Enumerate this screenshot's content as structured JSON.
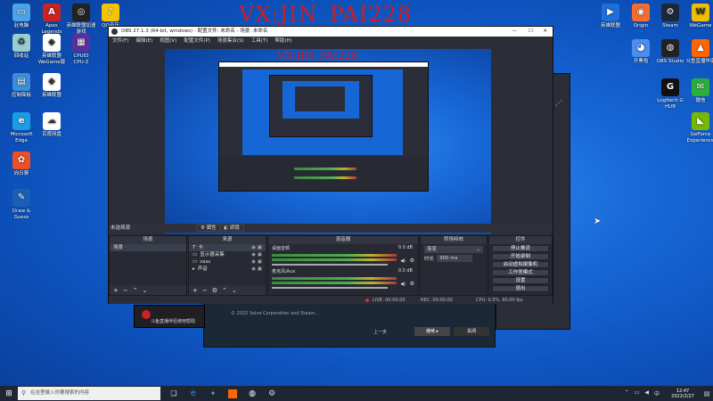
{
  "watermark": "VX:JIN_PAI228",
  "preview_watermark": "VX:JIN_PAI228",
  "desktop_left": [
    {
      "label": "此电脑",
      "icon": "computer-icon",
      "color": "#4aa3e6",
      "glyph": "▭"
    },
    {
      "label": "Apex\nLegends",
      "icon": "apex-icon",
      "color": "#c22",
      "glyph": "A"
    },
    {
      "label": "英雄联盟加速\n游戏",
      "icon": "lol-icon",
      "color": "#222",
      "glyph": "◎"
    },
    {
      "label": "QQ音乐",
      "icon": "qqmusic-icon",
      "color": "#f5c400",
      "glyph": "♪"
    },
    {
      "label": "回收站",
      "icon": "recycle-bin-icon",
      "color": "#9cc",
      "glyph": "♻"
    },
    {
      "label": "英雄联盟\nWeGame版",
      "icon": "wegame-lol-icon",
      "color": "#fff",
      "glyph": "◆"
    },
    {
      "label": "CPUID\nCPU-Z",
      "icon": "cpuz-icon",
      "color": "#5a2fa0",
      "glyph": "▦"
    },
    {
      "label": "控制面板",
      "icon": "control-panel-icon",
      "color": "#3a8fd9",
      "glyph": "▤"
    },
    {
      "label": "英雄联盟",
      "icon": "lol2-icon",
      "color": "#fff",
      "glyph": "◆"
    },
    {
      "label": "Microsoft\nEdge",
      "icon": "edge-icon",
      "color": "#1b9de2",
      "glyph": "e"
    },
    {
      "label": "百度网盘",
      "icon": "baidu-icon",
      "color": "#fff",
      "glyph": "☁"
    },
    {
      "label": "向日葵",
      "icon": "sunlogin-icon",
      "color": "#f04f23",
      "glyph": "✿"
    },
    {
      "label": "Draw &\nGuess",
      "icon": "draw-guess-icon",
      "color": "#1a5fb4",
      "glyph": "✎"
    }
  ],
  "desktop_right": [
    {
      "label": "英雄联盟",
      "icon": "lol-right-icon",
      "color": "#1e6fd9",
      "glyph": "▶"
    },
    {
      "label": "Origin",
      "icon": "origin-icon",
      "color": "#f56c2d",
      "glyph": "◉"
    },
    {
      "label": "Steam",
      "icon": "steam-icon",
      "color": "#1b2838",
      "glyph": "⚙"
    },
    {
      "label": "WeGame",
      "icon": "wegame-icon",
      "color": "#f0c000",
      "glyph": "W"
    },
    {
      "label": "开黑啦",
      "icon": "kaiheila-icon",
      "color": "#4a8ef0",
      "glyph": "◕"
    },
    {
      "label": "OBS Studio",
      "icon": "obs-icon",
      "color": "#222",
      "glyph": "◍"
    },
    {
      "label": "斗鱼直播伴侣",
      "icon": "douyu-icon",
      "color": "#f60",
      "glyph": "▲"
    },
    {
      "label": "Logitech G\nHUB",
      "icon": "ghub-icon",
      "color": "#111",
      "glyph": "G"
    },
    {
      "label": "微信",
      "icon": "wechat-icon",
      "color": "#2bae3c",
      "glyph": "✉"
    },
    {
      "label": "GeForce\nExperience",
      "icon": "geforce-icon",
      "color": "#76b900",
      "glyph": "◣"
    }
  ],
  "obs": {
    "title": "OBS 27.1.3 (64-bit, windows) - 配置文件: 未命名 - 场景: 未命名",
    "menu": [
      "文件(F)",
      "编辑(E)",
      "视图(V)",
      "配置文件(P)",
      "场景集合(S)",
      "工具(T)",
      "帮助(H)"
    ],
    "selected_source": "未选择源",
    "props_button": "属性",
    "filters_button": "滤镜",
    "docks": {
      "scenes": "场景",
      "sources": "来源",
      "mixer": "混音器",
      "transitions": "转场特效",
      "controls": "控件"
    },
    "scene_item": "场景",
    "sources": [
      {
        "name": "卡",
        "kind": "T"
      },
      {
        "name": "显示器采集",
        "kind": "▭"
      },
      {
        "name": "sass",
        "kind": "▭"
      },
      {
        "name": "声音",
        "kind": "▸"
      }
    ],
    "mixer": [
      {
        "name": "桌面音频",
        "db": "0.0 dB"
      },
      {
        "name": "麦克风/Aux",
        "db": "0.0 dB"
      }
    ],
    "transition_type": "渐变",
    "duration_label": "时长",
    "duration_value": "300 ms",
    "controls": [
      "停止推流",
      "开始录制",
      "启动虚拟摄像机",
      "工作室模式",
      "设置",
      "退出"
    ],
    "status": {
      "live": "LIVE: 00:00:00",
      "rec": "REC: 00:00:00",
      "cpu": "CPU: 0.5%, 60.00 fps"
    }
  },
  "bg_window": {
    "footer": "© 2022 Valve Corporation and Steam...",
    "btn1": "上一步",
    "btn2": "继续 ▸",
    "btn3": "关闭"
  },
  "douyu_popup": "斗鱼直播伴侣使用帮助",
  "taskbar": {
    "search_placeholder": "在这里输入你要搜索的内容",
    "time": "12:47",
    "date": "2022/2/27"
  }
}
